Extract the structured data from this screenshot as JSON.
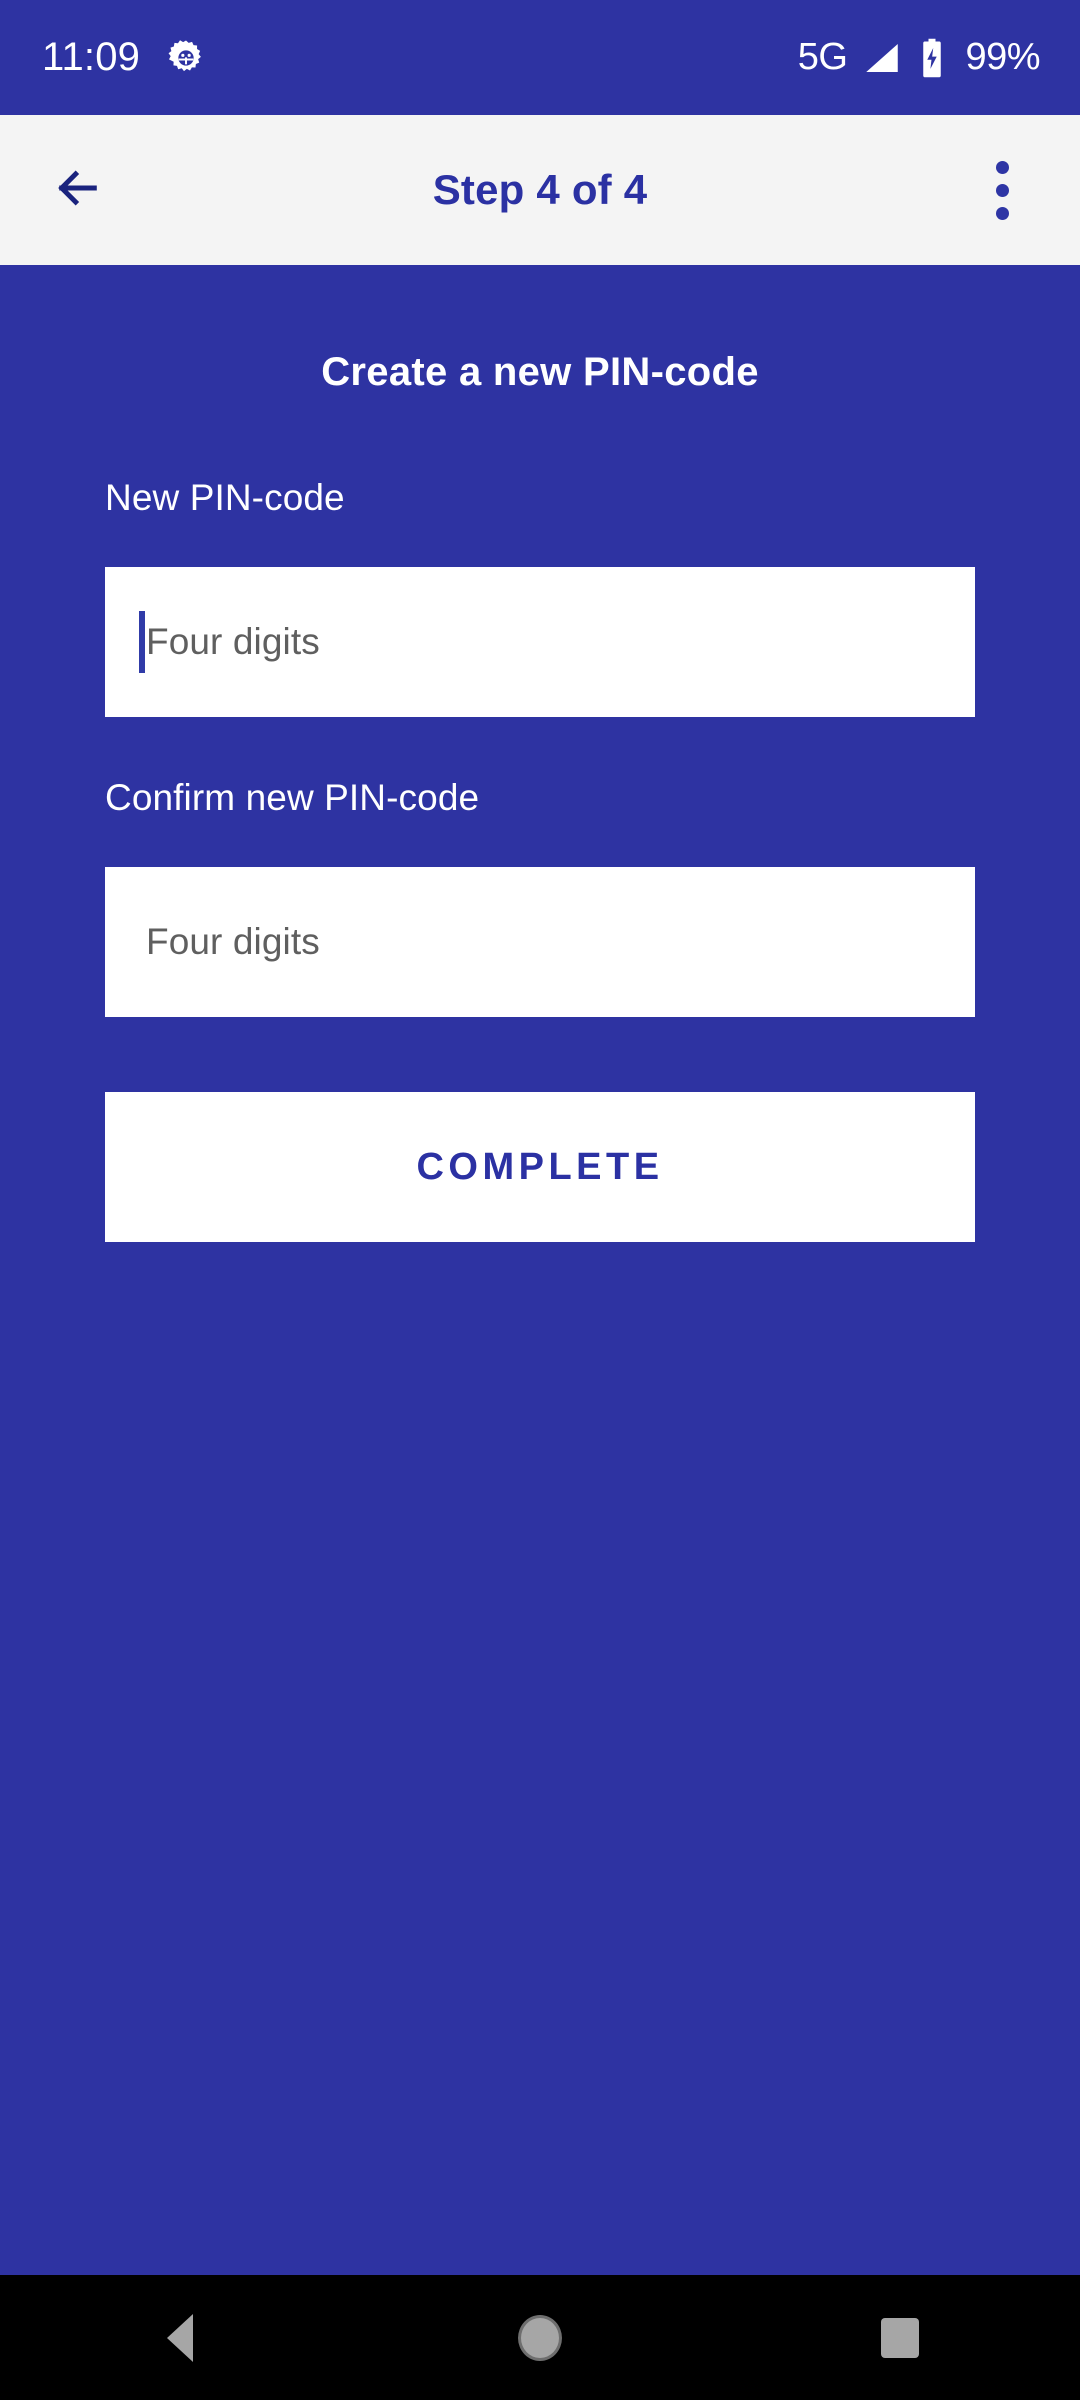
{
  "status_bar": {
    "time": "11:09",
    "notification_icon": "gear-icon",
    "network_type": "5G",
    "signal_icon": "signal-bars-icon",
    "battery_icon": "battery-charging-icon",
    "battery_percent": "99%",
    "background_color": "#2E33A2",
    "text_color": "#FFFFFF"
  },
  "app_bar": {
    "back_icon": "arrow-left-icon",
    "title": "Step 4 of 4",
    "overflow_icon": "more-vertical-icon",
    "background_color": "#F4F4F4",
    "title_color": "#2B31A3"
  },
  "content": {
    "heading": "Create a new PIN-code",
    "background_color": "#2E33A2",
    "fields": [
      {
        "label": "New PIN-code",
        "placeholder": "Four digits",
        "value": "",
        "focused": true
      },
      {
        "label": "Confirm new PIN-code",
        "placeholder": "Four digits",
        "value": "",
        "focused": false
      }
    ],
    "submit_button": {
      "label": "COMPLETE",
      "text_color": "#2B31A3",
      "background_color": "#FFFFFF"
    }
  },
  "nav_bar": {
    "background_color": "#000000",
    "back_icon": "triangle-back-icon",
    "home_icon": "circle-home-icon",
    "recents_icon": "square-recents-icon"
  }
}
